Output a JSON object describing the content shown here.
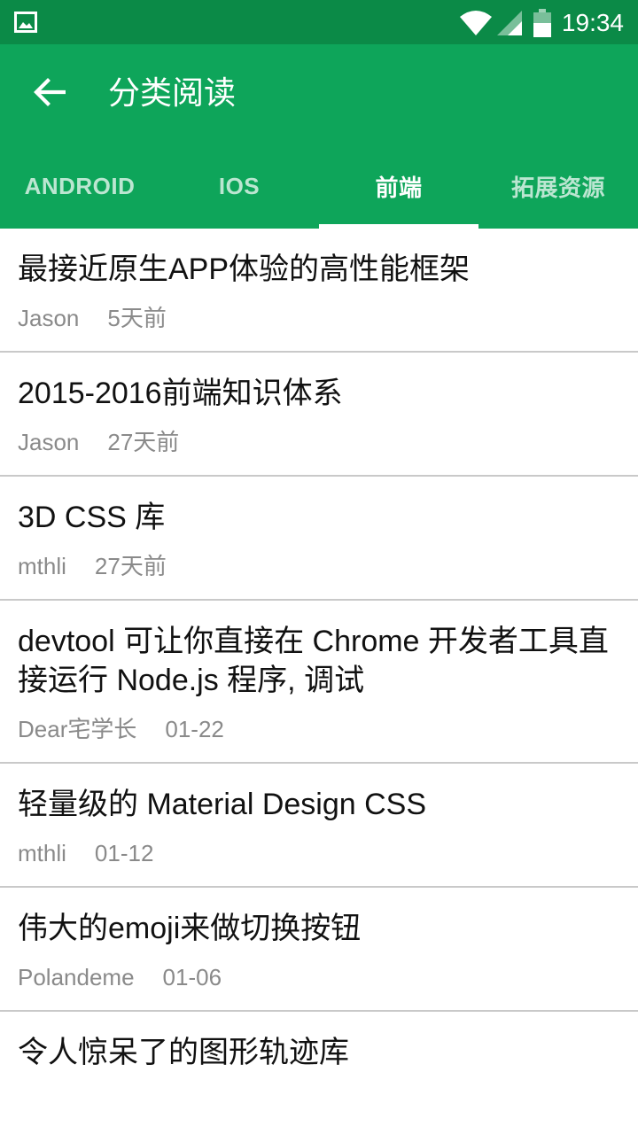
{
  "status_bar": {
    "time": "19:34",
    "icons": [
      "image-icon",
      "wifi-icon",
      "signal-icon",
      "battery-icon"
    ],
    "color": "#0b8a47"
  },
  "app_bar": {
    "title": "分类阅读",
    "color": "#0ea55a",
    "back_icon": "arrow-left-icon"
  },
  "tabs": [
    {
      "label": "ANDROID",
      "active": false
    },
    {
      "label": "IOS",
      "active": false
    },
    {
      "label": "前端",
      "active": true
    },
    {
      "label": "拓展资源",
      "active": false
    }
  ],
  "articles": [
    {
      "title": "最接近原生APP体验的高性能框架",
      "author": "Jason",
      "time": "5天前"
    },
    {
      "title": "2015-2016前端知识体系",
      "author": "Jason",
      "time": "27天前"
    },
    {
      "title": "3D CSS 库",
      "author": "mthli",
      "time": "27天前"
    },
    {
      "title": "devtool 可让你直接在 Chrome 开发者工具直接运行 Node.js 程序, 调试",
      "author": "Dear宅学长",
      "time": "01-22"
    },
    {
      "title": "轻量级的 Material Design CSS",
      "author": "mthli",
      "time": "01-12"
    },
    {
      "title": "伟大的emoji来做切换按钮",
      "author": "Polandeme",
      "time": "01-06"
    },
    {
      "title": "令人惊呆了的图形轨迹库",
      "author": "",
      "time": ""
    }
  ]
}
